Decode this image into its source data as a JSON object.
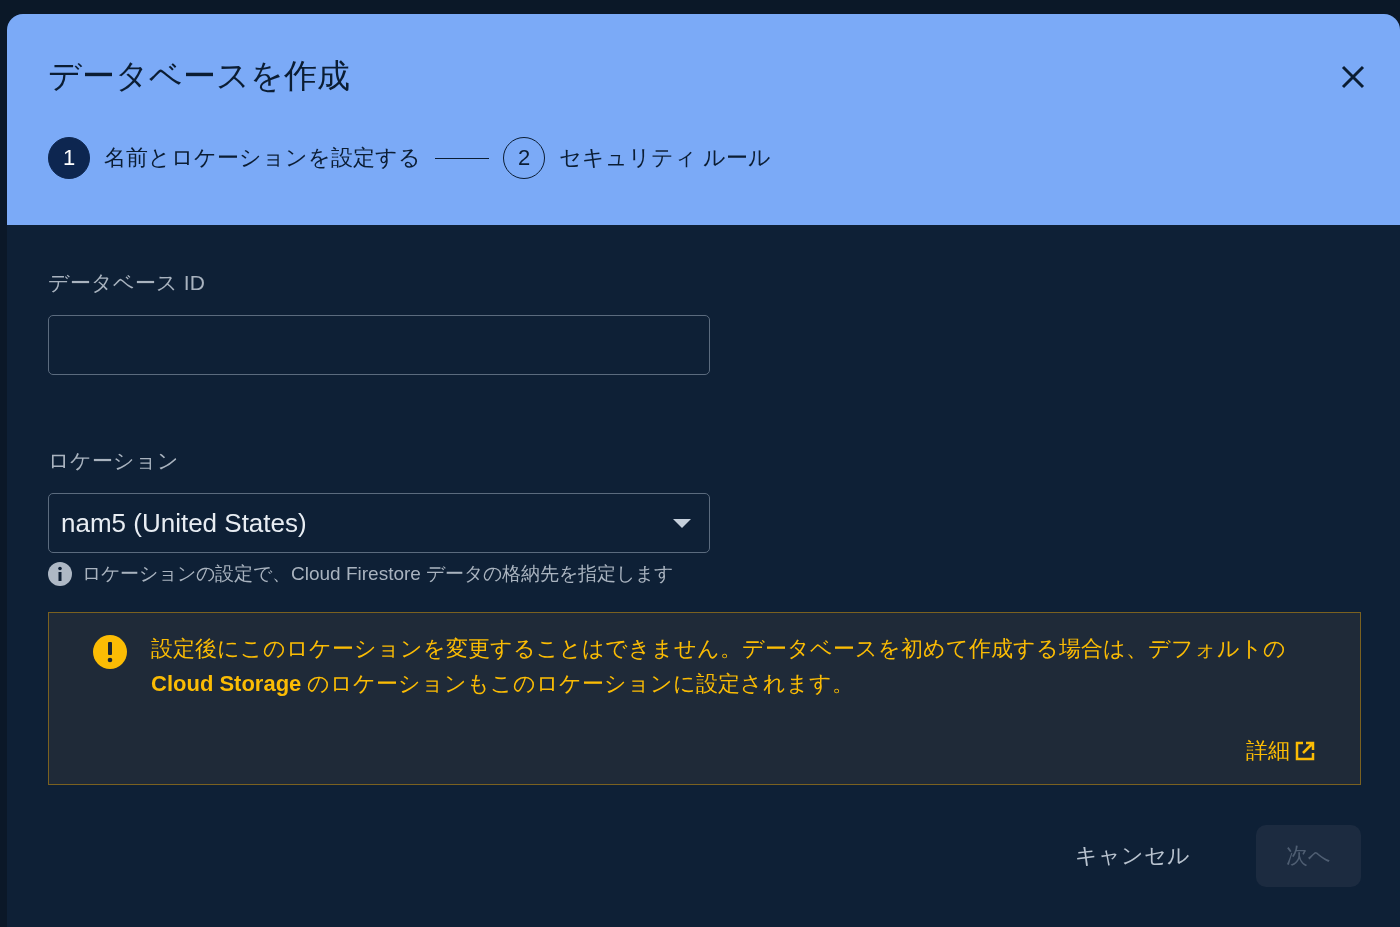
{
  "dialog": {
    "title": "データベースを作成",
    "steps": [
      {
        "number": "1",
        "label": "名前とロケーションを設定する",
        "selected": true
      },
      {
        "number": "2",
        "label": "セキュリティ ルール",
        "selected": false
      }
    ]
  },
  "database_id": {
    "label": "データベース ID"
  },
  "location": {
    "label": "ロケーション",
    "value": "nam5 (United States)",
    "hint": "ロケーションの設定で、Cloud Firestore データの格納先を指定します"
  },
  "warning": {
    "text": "設定後にこのロケーションを変更することはできません。データベースを初めて作成する場合は、デフォルトの **Cloud Storage** のロケーションもこのロケーションに設定されます。",
    "link": "詳細"
  },
  "buttons": [
    {
      "label": "キャンセル",
      "disabled": false
    },
    {
      "label": "次へ",
      "disabled": true
    }
  ]
}
